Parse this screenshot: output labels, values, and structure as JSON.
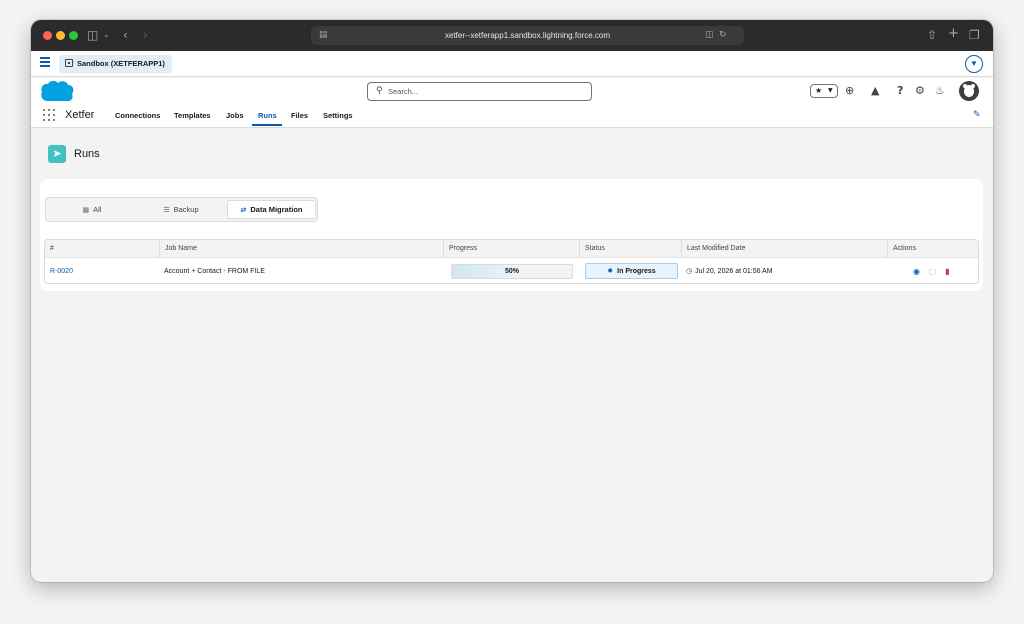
{
  "browser": {
    "url": "xetfer--xetferapp1.sandbox.lightning.force.com"
  },
  "sandbox": {
    "label": "Sandbox (XETFERAPP1)"
  },
  "header": {
    "search_placeholder": "Search..."
  },
  "nav": {
    "app_name": "Xetfer",
    "items": [
      "Connections",
      "Templates",
      "Jobs",
      "Runs",
      "Files",
      "Settings"
    ],
    "active": "Runs"
  },
  "page": {
    "title": "Runs",
    "icon": "runs-icon",
    "accent_color": "#3fc2c1"
  },
  "tabs": [
    {
      "label": "All",
      "icon": "grid-icon"
    },
    {
      "label": "Backup",
      "icon": "database-icon"
    },
    {
      "label": "Data Migration",
      "icon": "sync-icon",
      "active": true
    }
  ],
  "table": {
    "columns": [
      "#",
      "Job Name",
      "Progress",
      "Status",
      "Last Modified Date",
      "Actions"
    ],
    "rows": [
      {
        "id": "R-0020",
        "job_name": "Account + Contact - FROM FILE",
        "progress_label": "50%",
        "progress": 0.5,
        "status": "In Progress",
        "last_modified": "Jul 20, 2026 at 01:56 AM"
      }
    ]
  },
  "colors": {
    "brand_blue": "#0b5cab",
    "delete_red": "#c23934",
    "status_bg": "#e9f3fb"
  }
}
